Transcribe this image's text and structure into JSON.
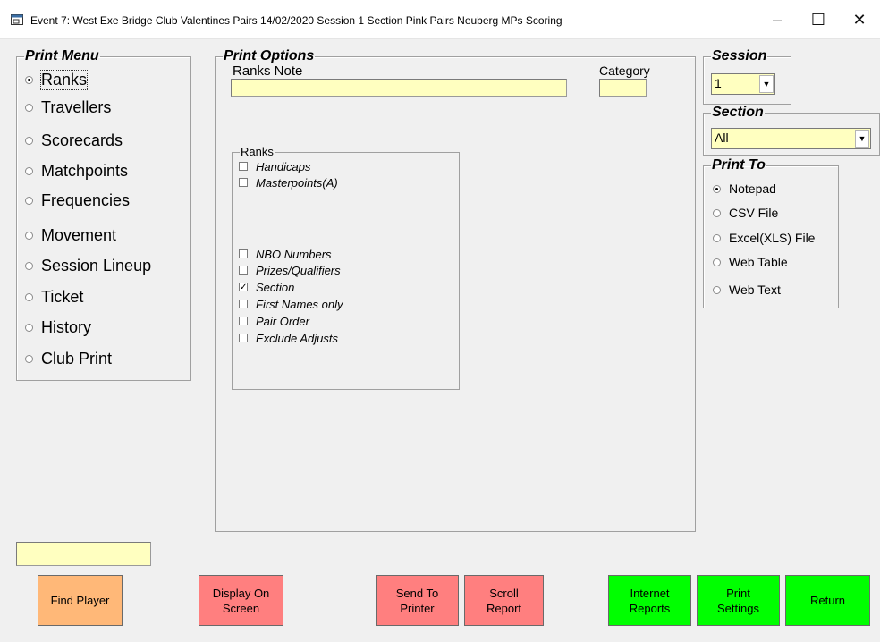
{
  "window": {
    "title": "Event 7: West Exe Bridge Club Valentines Pairs 14/02/2020 Session 1 Section Pink Pairs Neuberg MPs Scoring",
    "minimize_glyph": "–",
    "maximize_glyph": "☐",
    "close_glyph": "✕"
  },
  "print_menu": {
    "legend": "Print Menu",
    "selected": "Ranks",
    "items": [
      "Ranks",
      "Travellers",
      "Scorecards",
      "Matchpoints",
      "Frequencies",
      "Movement",
      "Session Lineup",
      "Ticket",
      "History",
      "Club Print"
    ]
  },
  "print_options": {
    "legend": "Print Options",
    "ranks_note_label": "Ranks Note",
    "ranks_note_value": "",
    "category_label": "Category",
    "category_value": "",
    "ranks_group": {
      "label": "Ranks",
      "options": [
        {
          "label": "Handicaps",
          "checked": false
        },
        {
          "label": "Masterpoints(A)",
          "checked": false
        },
        {
          "label": "NBO Numbers",
          "checked": false
        },
        {
          "label": "Prizes/Qualifiers",
          "checked": false
        },
        {
          "label": "Section",
          "checked": true
        },
        {
          "label": "First Names only",
          "checked": false
        },
        {
          "label": "Pair Order",
          "checked": false
        },
        {
          "label": "Exclude Adjusts",
          "checked": false
        }
      ]
    }
  },
  "session": {
    "legend": "Session",
    "value": "1"
  },
  "section": {
    "legend": "Section",
    "value": "All"
  },
  "print_to": {
    "legend": "Print To",
    "selected": "Notepad",
    "items": [
      "Notepad",
      "CSV File",
      "Excel(XLS) File",
      "Web Table",
      "Web Text"
    ]
  },
  "find_player_value": "",
  "buttons": {
    "find_player": "Find Player",
    "display_on_screen": "Display On\nScreen",
    "send_to_printer": "Send To\nPrinter",
    "scroll_report": "Scroll\nReport",
    "internet_reports": "Internet\nReports",
    "print_settings": "Print\nSettings",
    "return": "Return"
  },
  "colors": {
    "field_yellow": "#ffffc0",
    "button_orange": "#ffb878",
    "button_red": "#ff7f7f",
    "button_green": "#00ff00"
  }
}
